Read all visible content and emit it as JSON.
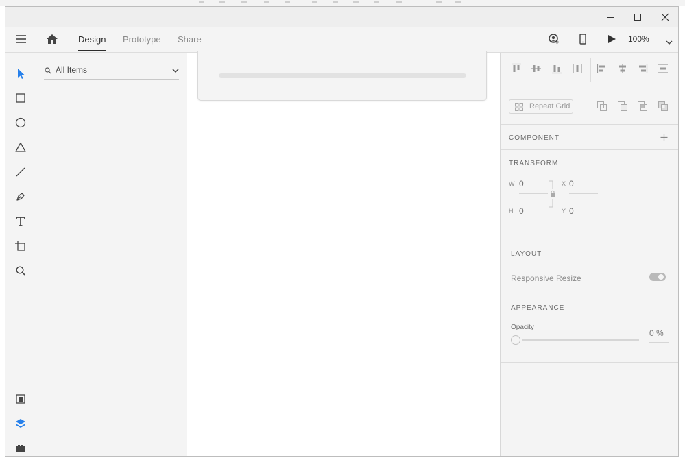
{
  "app": {
    "tabs": [
      {
        "label": "Design",
        "active": true
      },
      {
        "label": "Prototype",
        "active": false
      },
      {
        "label": "Share",
        "active": false
      }
    ],
    "zoom": "100%",
    "accent_color": "#2680eb"
  },
  "layers": {
    "filter_label": "All Items"
  },
  "properties": {
    "repeat_grid_label": "Repeat Grid",
    "component_title": "COMPONENT",
    "transform": {
      "title": "TRANSFORM",
      "w_label": "W",
      "w_value": "0",
      "h_label": "H",
      "h_value": "0",
      "x_label": "X",
      "x_value": "0",
      "y_label": "Y",
      "y_value": "0"
    },
    "layout": {
      "title": "LAYOUT",
      "responsive_resize_label": "Responsive Resize"
    },
    "appearance": {
      "title": "APPEARANCE",
      "opacity_label": "Opacity",
      "opacity_value": "0 %"
    }
  }
}
